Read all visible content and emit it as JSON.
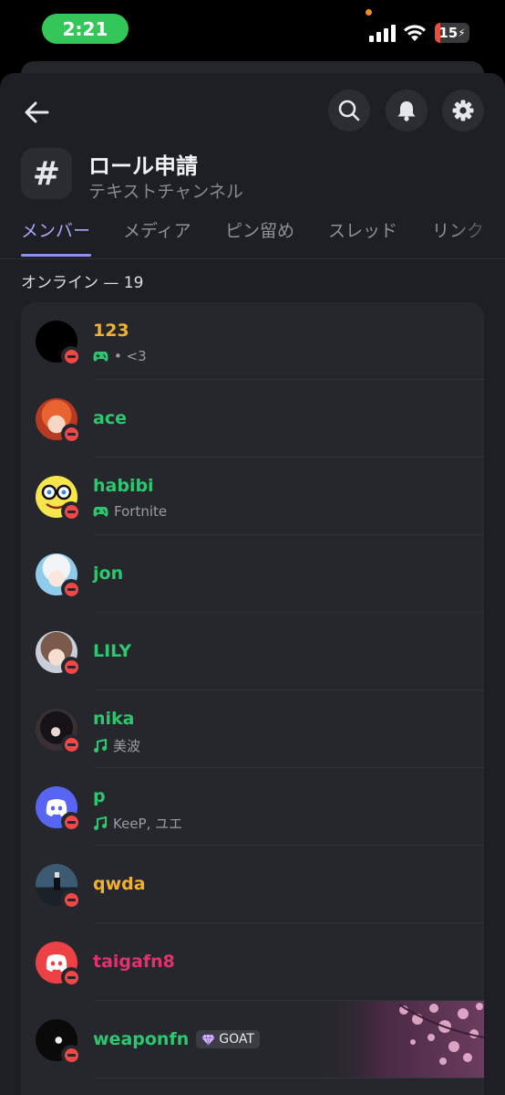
{
  "status_bar": {
    "time": "2:21",
    "battery": "15",
    "battery_level": 0.15
  },
  "header": {
    "channel_icon": "#",
    "channel_name": "ロール申請",
    "channel_type": "テキストチャンネル",
    "icons": [
      "back-arrow-icon",
      "search-icon",
      "bell-icon",
      "gear-icon"
    ]
  },
  "tabs": [
    "メンバー",
    "メディア",
    "ピン留め",
    "スレッド",
    "リンク"
  ],
  "section": {
    "label": "オンライン — 19"
  },
  "colors": {
    "green": "#2dc770",
    "gold": "#f0b132",
    "pink": "#e3316b",
    "blurple": "#5865f2",
    "red_avatar": "#ed4245",
    "dnd": "#f04747"
  },
  "members": [
    {
      "name": "123",
      "status": "• <3",
      "status_icon": "gamepad-icon",
      "color": "#f0b132"
    },
    {
      "name": "ace",
      "status": "",
      "color": "#2dc770"
    },
    {
      "name": "habibi",
      "status": "Fortnite",
      "status_icon": "gamepad-icon",
      "color": "#2dc770"
    },
    {
      "name": "jon",
      "status": "",
      "color": "#2dc770"
    },
    {
      "name": "LILY",
      "status": "",
      "color": "#2dc770"
    },
    {
      "name": "nika",
      "status": "美波",
      "status_icon": "music-note-icon",
      "color": "#2dc770"
    },
    {
      "name": "p",
      "status": "KeeP, ユエ",
      "status_icon": "music-note-icon",
      "color": "#2dc770"
    },
    {
      "name": "qwda",
      "status": "",
      "color": "#f0b132"
    },
    {
      "name": "taigafn8",
      "status": "",
      "color": "#e3316b"
    },
    {
      "name": "weaponfn",
      "status": "",
      "badge": "GOAT",
      "badge_icon": "gem-icon",
      "color": "#2dc770"
    }
  ]
}
